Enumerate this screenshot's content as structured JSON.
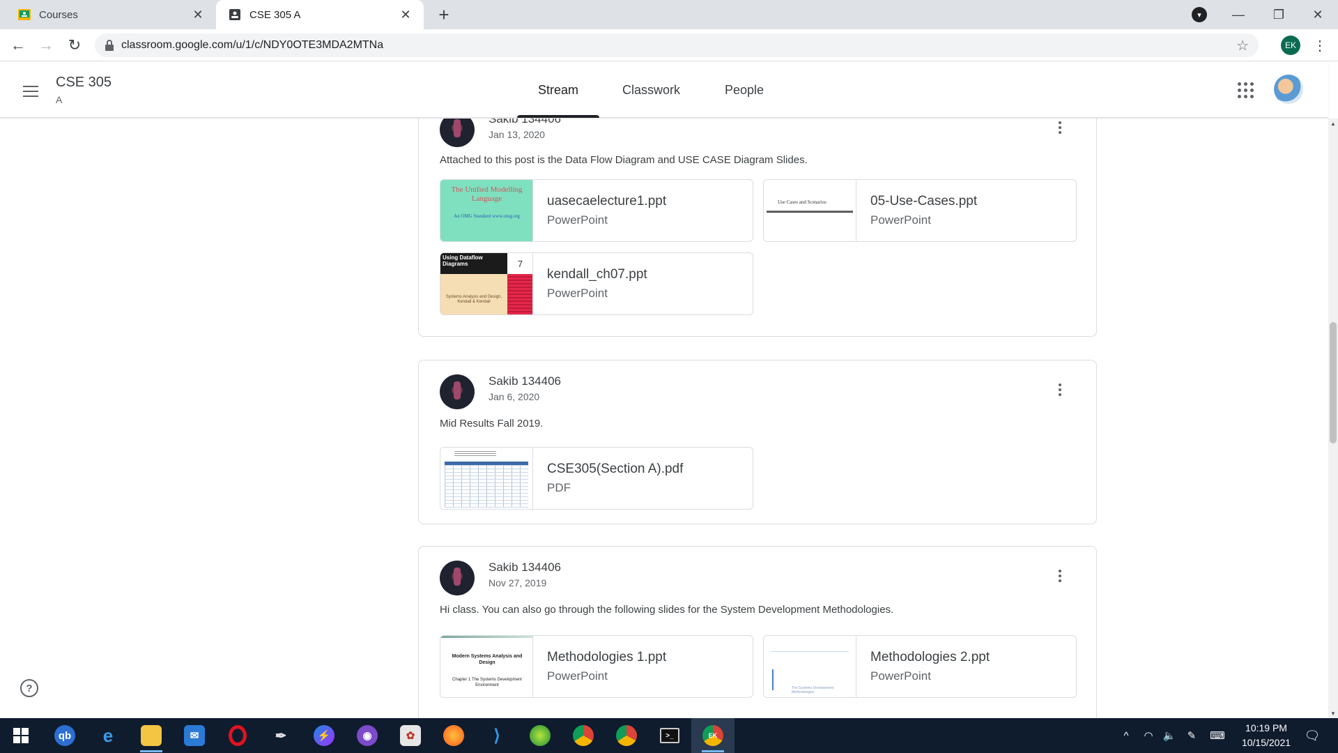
{
  "browser": {
    "tabs": [
      {
        "title": "Courses",
        "favicon": "classroom-icon"
      },
      {
        "title": "CSE 305 A",
        "favicon": "classroom-icon"
      }
    ],
    "url": "classroom.google.com/u/1/c/NDY0OTE3MDA2MTNa",
    "profile_initials": "EK"
  },
  "classroom": {
    "class_name": "CSE 305",
    "section": "A",
    "tabs": [
      "Stream",
      "Classwork",
      "People"
    ],
    "active_tab": "Stream"
  },
  "posts": [
    {
      "author": "Sakib 134406",
      "date": "Jan 13, 2020",
      "body": "Attached to this post is the Data Flow Diagram and USE CASE Diagram Slides.",
      "attachments": [
        {
          "name": "uasecaelecture1.ppt",
          "type": "PowerPoint",
          "thumb_title": "The Unified Modelling Language",
          "thumb_sub": "An OMG Standard www.omg.org"
        },
        {
          "name": "05-Use-Cases.ppt",
          "type": "PowerPoint",
          "thumb_title": "Use Cases and Scenarios"
        },
        {
          "name": "kendall_ch07.ppt",
          "type": "PowerPoint",
          "thumb_title": "Using Dataflow Diagrams",
          "thumb_num": "7",
          "thumb_sub": "Systems Analysis and Design, Kendall & Kendall"
        }
      ]
    },
    {
      "author": "Sakib 134406",
      "date": "Jan 6, 2020",
      "body": "Mid Results Fall 2019.",
      "attachments": [
        {
          "name": "CSE305(Section A).pdf",
          "type": "PDF"
        }
      ]
    },
    {
      "author": "Sakib 134406",
      "date": "Nov 27, 2019",
      "body": "Hi class. You can also go through the following slides for the System Development Methodologies.",
      "attachments": [
        {
          "name": "Methodologies 1.ppt",
          "type": "PowerPoint",
          "thumb_title": "Modern Systems Analysis and Design",
          "thumb_sub": "Chapter 1 The Systems Development Environment"
        },
        {
          "name": "Methodologies 2.ppt",
          "type": "PowerPoint",
          "thumb_sub": "The Systems Development Methodologies"
        }
      ]
    }
  ],
  "taskbar": {
    "apps": [
      "start",
      "search-qb",
      "edge",
      "file-explorer",
      "mail",
      "opera",
      "inkscape",
      "messenger",
      "github-desktop",
      "paint",
      "firefox",
      "vscode",
      "coreldraw",
      "chrome-profile",
      "chrome",
      "terminal",
      "chrome-ek"
    ],
    "time": "10:19 PM",
    "date": "10/15/2021"
  },
  "colors": {
    "tabstrip": "#dee1e6",
    "taskbar": "#0f1c2e",
    "profile_chip": "#0b6b52"
  }
}
